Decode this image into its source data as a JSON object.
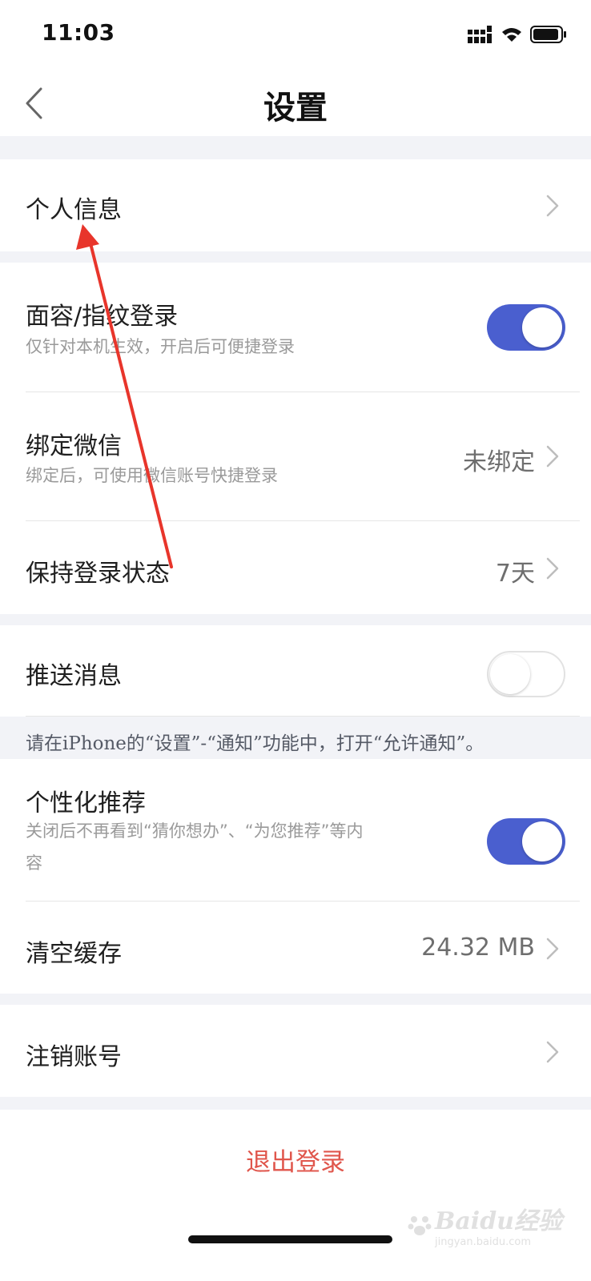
{
  "status_bar": {
    "time": "11:03"
  },
  "nav": {
    "title": "设置",
    "back_icon": "chevron-left-icon"
  },
  "rows": {
    "personal_info": {
      "title": "个人信息"
    },
    "biometric_login": {
      "title": "面容/指纹登录",
      "subtitle": "仅针对本机生效，开启后可便捷登录",
      "toggle_on": true
    },
    "bind_wechat": {
      "title": "绑定微信",
      "subtitle": "绑定后，可使用微信账号快捷登录",
      "value": "未绑定"
    },
    "keep_login": {
      "title": "保持登录状态",
      "value": "7天"
    },
    "push": {
      "title": "推送消息",
      "toggle_on": false
    },
    "push_notice": "请在iPhone的“设置”-“通知”功能中，打开“允许通知”。",
    "personalized": {
      "title": "个性化推荐",
      "subtitle_line1": "关闭后不再看到“猜你想办”、“为您推荐”等内",
      "subtitle_line2": "容",
      "toggle_on": true
    },
    "clear_cache": {
      "title": "清空缓存",
      "value": "24.32 MB"
    },
    "cancel_account": {
      "title": "注销账号"
    }
  },
  "logout": {
    "label": "退出登录"
  },
  "watermark": {
    "text": "Baidu经验",
    "sub": "jingyan.baidu.com"
  },
  "colors": {
    "accent": "#4a5fcf",
    "danger": "#e0564c",
    "background": "#f2f3f7",
    "annotation": "#e8352b"
  }
}
